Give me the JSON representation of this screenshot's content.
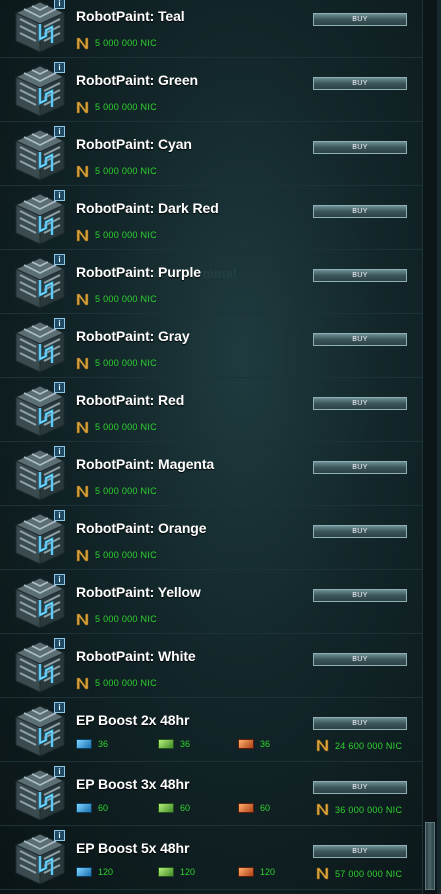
{
  "window": {
    "watermark_text": "Main Terminal"
  },
  "buy_label": "BUY",
  "info_label": "i",
  "items": [
    {
      "name": "RobotPaint: Teal",
      "price": "5 000 000 NIC"
    },
    {
      "name": "RobotPaint: Green",
      "price": "5 000 000 NIC"
    },
    {
      "name": "RobotPaint: Cyan",
      "price": "5 000 000 NIC"
    },
    {
      "name": "RobotPaint: Dark Red",
      "price": "5 000 000 NIC"
    },
    {
      "name": "RobotPaint: Purple",
      "price": "5 000 000 NIC"
    },
    {
      "name": "RobotPaint: Gray",
      "price": "5 000 000 NIC"
    },
    {
      "name": "RobotPaint: Red",
      "price": "5 000 000 NIC"
    },
    {
      "name": "RobotPaint: Magenta",
      "price": "5 000 000 NIC"
    },
    {
      "name": "RobotPaint: Orange",
      "price": "5 000 000 NIC"
    },
    {
      "name": "RobotPaint: Yellow",
      "price": "5 000 000 NIC"
    },
    {
      "name": "RobotPaint: White",
      "price": "5 000 000 NIC"
    },
    {
      "name": "EP Boost 2x 48hr",
      "blue": "36",
      "green": "36",
      "red": "36",
      "price": "24 600 000 NIC"
    },
    {
      "name": "EP Boost 3x 48hr",
      "blue": "60",
      "green": "60",
      "red": "60",
      "price": "36 000 000 NIC"
    },
    {
      "name": "EP Boost 5x 48hr",
      "blue": "120",
      "green": "120",
      "red": "120",
      "price": "57 000 000 NIC"
    }
  ],
  "colors": {
    "price": "#2fd52f",
    "accent": "#27a9e1",
    "background": "#122528"
  }
}
